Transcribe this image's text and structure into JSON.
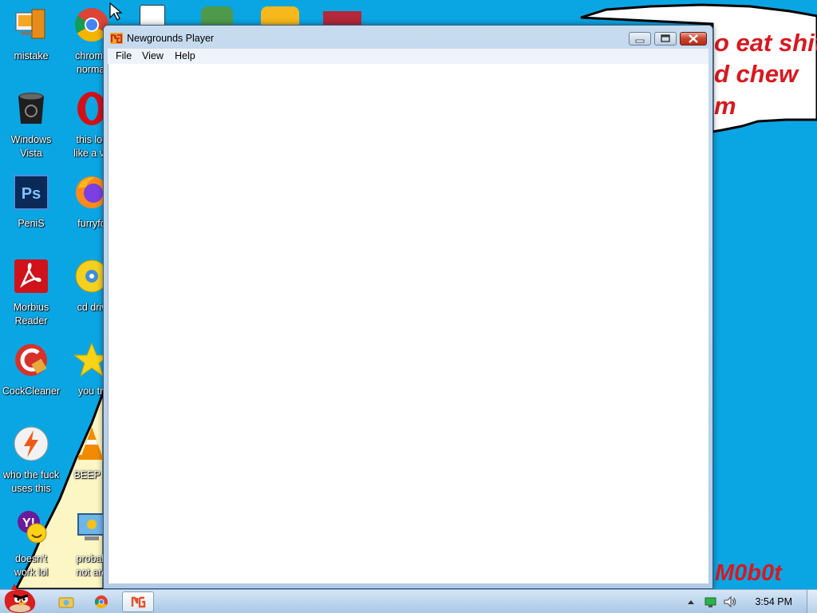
{
  "wallpaper": {
    "lines": [
      "o eat shit",
      "d chew",
      "m"
    ],
    "signature": "M0b0t"
  },
  "desktop_icons": [
    {
      "label": "mistake",
      "icon": "monitor-box-icon"
    },
    {
      "label": "chrome\nnormal",
      "icon": "chrome-icon"
    },
    {
      "label": "Windows\nVista",
      "icon": "trash-bin-icon"
    },
    {
      "label": "this loc\nlike a va",
      "icon": "opera-icon"
    },
    {
      "label": "PeniS",
      "icon": "photoshop-icon"
    },
    {
      "label": "furryfo",
      "icon": "firefox-icon"
    },
    {
      "label": "Morbius\nReader",
      "icon": "acrobat-icon"
    },
    {
      "label": "cd driv",
      "icon": "cd-drive-icon"
    },
    {
      "label": "CockCleaner",
      "icon": "ccleaner-icon"
    },
    {
      "label": "you tri",
      "icon": "star-icon"
    },
    {
      "label": "who the fuck\nuses this",
      "icon": "lightning-icon"
    },
    {
      "label": "BEEP B",
      "icon": "vlc-cone-icon"
    },
    {
      "label": "doesn't\nwork lol",
      "icon": "yahoo-messenger-icon"
    },
    {
      "label": "probab\nnot aro",
      "icon": "settings-monitor-icon"
    }
  ],
  "window": {
    "title": "Newgrounds Player",
    "menu": [
      "File",
      "View",
      "Help"
    ]
  },
  "taskbar": {
    "clock": "3:54 PM",
    "pinned": [
      "start-angry-bird-icon",
      "explorer-folder-icon",
      "chrome-icon",
      "newgrounds-icon"
    ]
  }
}
